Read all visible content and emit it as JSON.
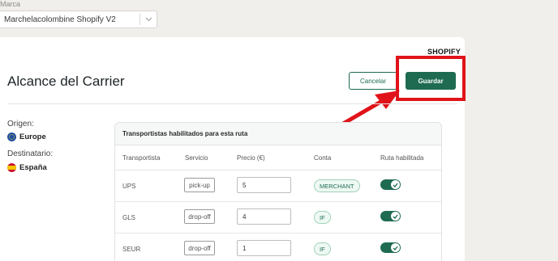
{
  "brand": {
    "label": "Marca",
    "selected": "Marchelacolombine Shopify V2"
  },
  "platform_tag": "SHOPIFY",
  "page_title": "Alcance del Carrier",
  "actions": {
    "cancel_label": "Cancelar",
    "save_label": "Guardar"
  },
  "route": {
    "origin_label": "Origen:",
    "origin_value": "Europe",
    "destination_label": "Destinatario:",
    "destination_value": "España"
  },
  "carriers_table": {
    "title": "Transportistas habilitados para esta ruta",
    "columns": [
      "Transportista",
      "Servicio",
      "Precio (€)",
      "Conta",
      "Ruta habilitada"
    ],
    "rows": [
      {
        "carrier": "UPS",
        "service": "pick-up",
        "price": "5",
        "account": "MERCHANT",
        "enabled": true
      },
      {
        "carrier": "GLS",
        "service": "drop-off",
        "price": "4",
        "account": "IF",
        "enabled": true
      },
      {
        "carrier": "SEUR",
        "service": "drop-off",
        "price": "1",
        "account": "IF",
        "enabled": true
      }
    ]
  },
  "colors": {
    "primary": "#1e6b52",
    "annotation": "#e0131a"
  },
  "icons": {
    "select_chevron": "chevron-down-icon",
    "origin_flag": "eu-flag-icon",
    "destination_flag": "spain-flag-icon",
    "toggle_check": "check-icon"
  }
}
